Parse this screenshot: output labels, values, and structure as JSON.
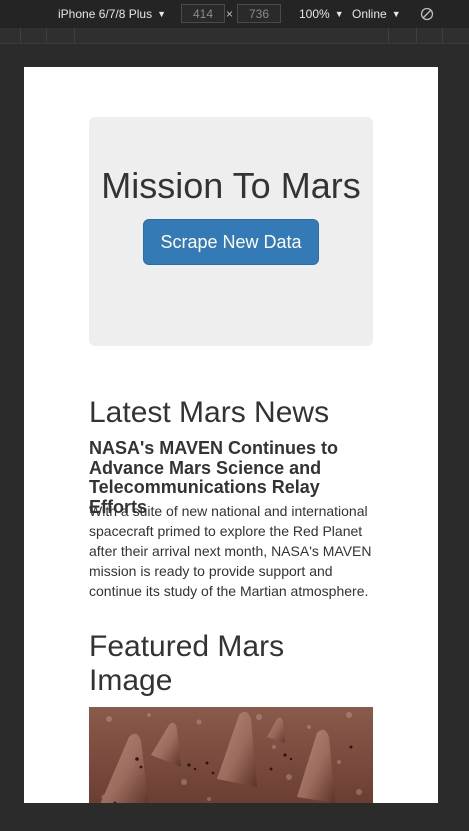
{
  "devtools": {
    "device": "iPhone 6/7/8 Plus",
    "width": "414",
    "separator": "×",
    "height": "736",
    "zoom": "100%",
    "network": "Online"
  },
  "page": {
    "title": "Mission To Mars",
    "scrape_button": "Scrape New Data",
    "news": {
      "heading": "Latest Mars News",
      "title": "NASA's MAVEN Continues to Advance Mars Science and Telecommunications Relay Efforts",
      "paragraph": "With a suite of new national and international spacecraft primed to explore the Red Planet after their arrival next month, NASA's MAVEN mission is ready to provide support and continue its study of the Martian atmosphere."
    },
    "featured": {
      "heading": "Featured Mars Image"
    }
  },
  "colors": {
    "button": "#337ab7",
    "jumbotron": "#eeeeee",
    "devtools_bg": "#242424"
  }
}
